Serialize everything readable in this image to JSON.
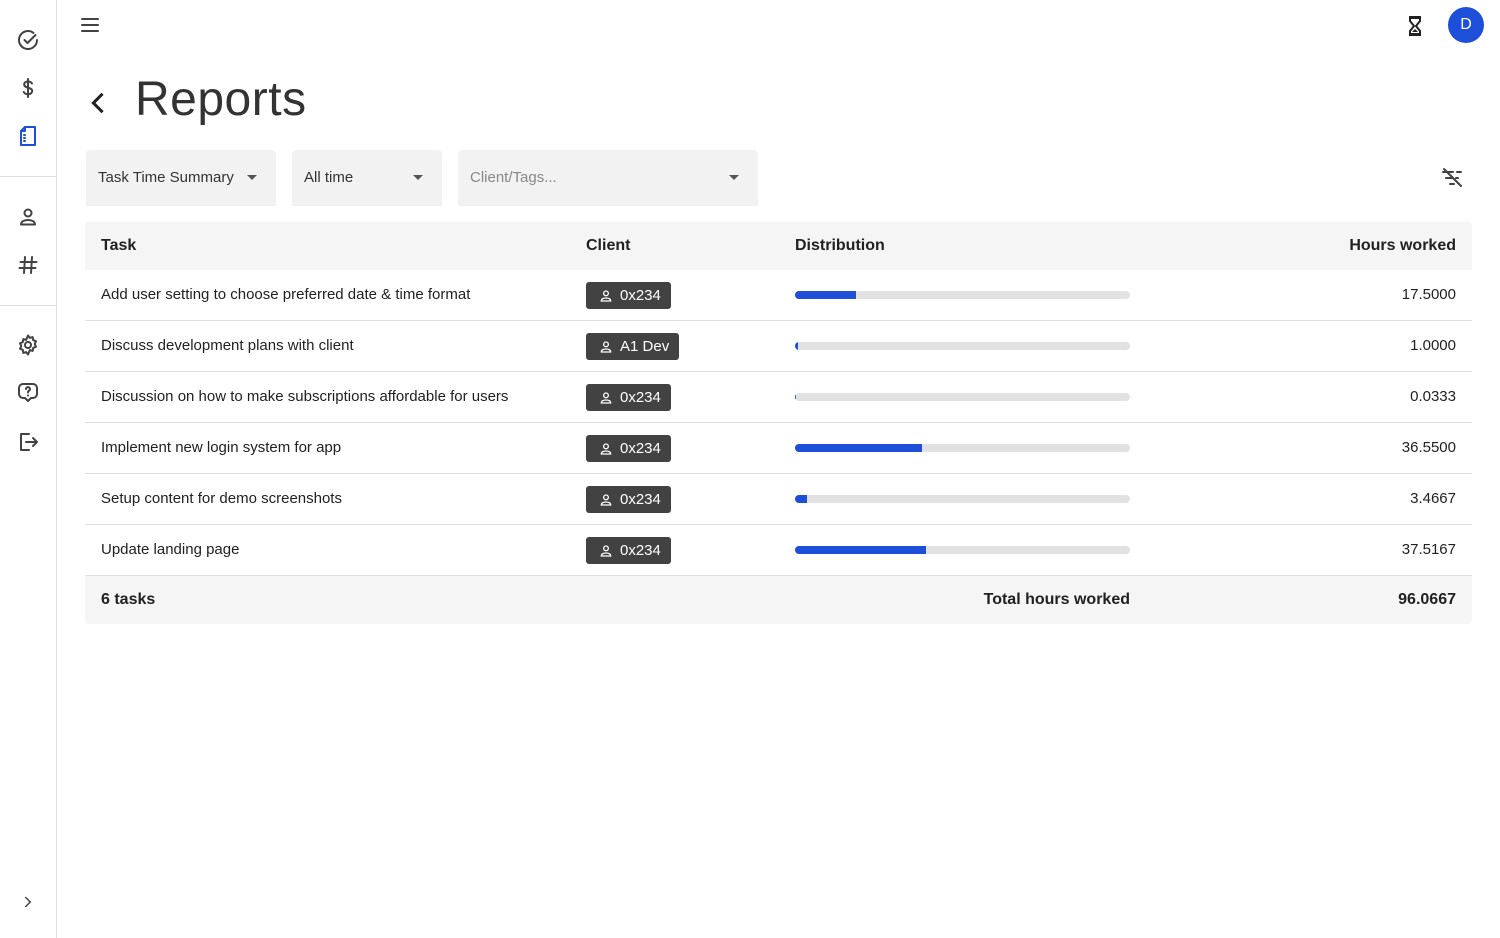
{
  "header": {
    "title": "Reports",
    "avatar_letter": "D"
  },
  "sidebar": {
    "items": [
      {
        "name": "tasks",
        "icon": "check-circle-icon"
      },
      {
        "name": "billing",
        "icon": "dollar-icon"
      },
      {
        "name": "reports",
        "icon": "report-icon",
        "active": true
      },
      {
        "name": "clients",
        "icon": "person-icon"
      },
      {
        "name": "tags",
        "icon": "hash-icon"
      },
      {
        "name": "settings",
        "icon": "gear-icon"
      },
      {
        "name": "help",
        "icon": "help-icon"
      },
      {
        "name": "logout",
        "icon": "logout-icon"
      },
      {
        "name": "expand",
        "icon": "chevron-right-icon"
      }
    ]
  },
  "filters": {
    "report_type": "Task Time Summary",
    "time_range": "All time",
    "client_tags_placeholder": "Client/Tags..."
  },
  "table": {
    "columns": {
      "task": "Task",
      "client": "Client",
      "distribution": "Distribution",
      "hours": "Hours worked"
    },
    "rows": [
      {
        "task": "Add user setting to choose preferred date & time format",
        "client": "0x234",
        "hours": "17.5000",
        "share": 0.182
      },
      {
        "task": "Discuss development plans with client",
        "client": "A1 Dev",
        "hours": "1.0000",
        "share": 0.0104
      },
      {
        "task": "Discussion on how to make subscriptions affordable for users",
        "client": "0x234",
        "hours": "0.0333",
        "share": 0.0003
      },
      {
        "task": "Implement new login system for app",
        "client": "0x234",
        "hours": "36.5500",
        "share": 0.3805
      },
      {
        "task": "Setup content for demo screenshots",
        "client": "0x234",
        "hours": "3.4667",
        "share": 0.0361
      },
      {
        "task": "Update landing page",
        "client": "0x234",
        "hours": "37.5167",
        "share": 0.3905
      }
    ],
    "footer": {
      "count": "6 tasks",
      "total_label": "Total hours worked",
      "total": "96.0667"
    }
  },
  "colors": {
    "accent": "#1e4fd8",
    "chip": "#424242"
  }
}
